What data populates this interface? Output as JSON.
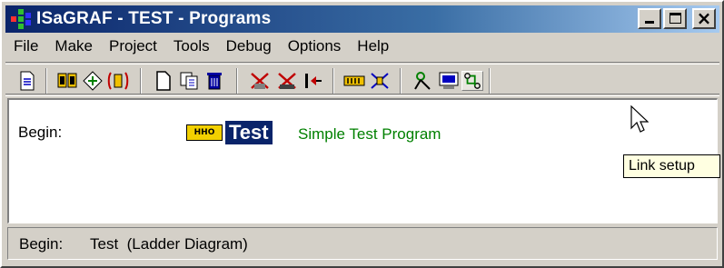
{
  "window": {
    "title": "ISaGRAF - TEST - Programs",
    "buttons": {
      "minimize": "minimize",
      "maximize": "maximize",
      "close": "×"
    }
  },
  "menu": {
    "items": [
      "File",
      "Make",
      "Project",
      "Tools",
      "Debug",
      "Options",
      "Help"
    ]
  },
  "toolbar": {
    "tools": [
      "edit-document-icon",
      "library-icon",
      "compile-icon",
      "verify-icon",
      "new-file-icon",
      "copy-icon",
      "delete-icon",
      "debug-breakpoint-icon",
      "stop-icon",
      "step-icon",
      "io-connection-icon",
      "simulate-icon",
      "link-monitor-icon",
      "display-icon",
      "link-setup-icon"
    ]
  },
  "programs": {
    "section_label": "Begin:",
    "items": [
      {
        "icon_text": "HHO",
        "name": "Test",
        "description": "Simple Test Program"
      }
    ]
  },
  "tooltip": {
    "text": "Link setup"
  },
  "status": {
    "section": "Begin:",
    "text": "Test  (Ladder Diagram)"
  },
  "colors": {
    "title_gradient_start": "#0a246a",
    "selection": "#0a246a",
    "description": "#008000",
    "tooltip_bg": "#ffffe1"
  }
}
